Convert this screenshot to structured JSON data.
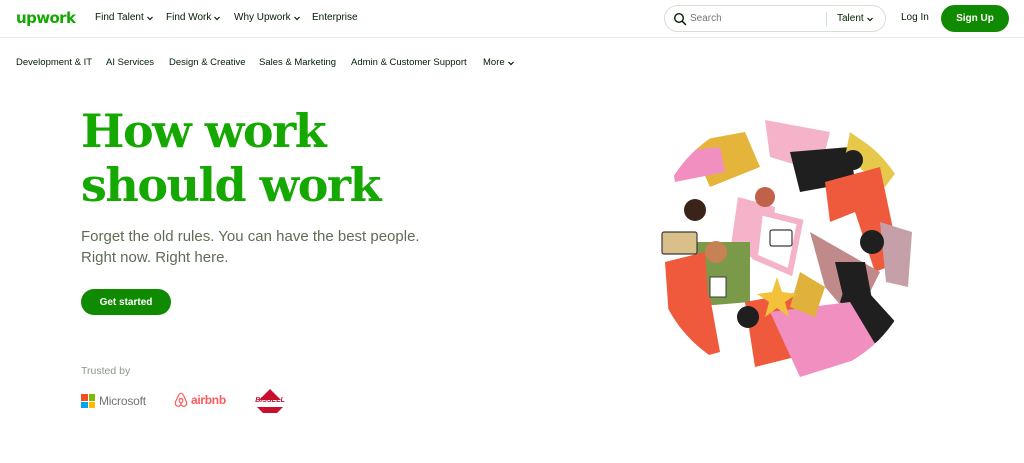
{
  "brand": {
    "logo_text": "upwork",
    "color": "#14a800",
    "button_color": "#108a00"
  },
  "topnav": {
    "items": [
      {
        "label": "Find Talent",
        "has_dropdown": true
      },
      {
        "label": "Find Work",
        "has_dropdown": true
      },
      {
        "label": "Why Upwork",
        "has_dropdown": true
      },
      {
        "label": "Enterprise",
        "has_dropdown": false
      }
    ],
    "search": {
      "placeholder": "Search",
      "scope": "Talent",
      "icon": "search-icon"
    },
    "login_label": "Log In",
    "signup_label": "Sign Up"
  },
  "categories": {
    "items": [
      {
        "label": "Development & IT"
      },
      {
        "label": "AI Services"
      },
      {
        "label": "Design & Creative"
      },
      {
        "label": "Sales & Marketing"
      },
      {
        "label": "Admin & Customer Support"
      },
      {
        "label": "More",
        "has_dropdown": true
      }
    ]
  },
  "hero": {
    "title_line1": "How work",
    "title_line2": "should work",
    "subtitle_line1": "Forget the old rules. You can have the best people.",
    "subtitle_line2": "Right now. Right here.",
    "cta_label": "Get started"
  },
  "trusted": {
    "label": "Trusted by",
    "logos": [
      {
        "name": "Microsoft",
        "icon": "microsoft-logo"
      },
      {
        "name": "airbnb",
        "icon": "airbnb-logo"
      },
      {
        "name": "BISSELL",
        "icon": "bissell-logo"
      }
    ]
  }
}
